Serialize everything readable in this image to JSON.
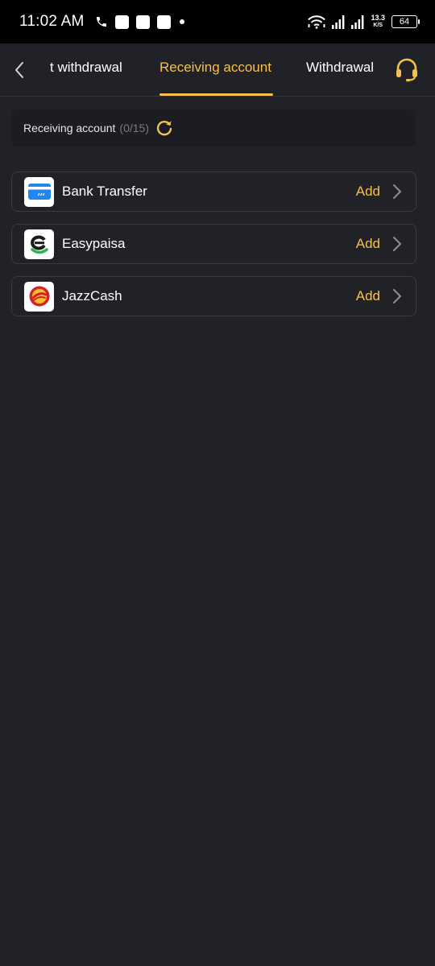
{
  "status_bar": {
    "time": "11:02 AM",
    "net_speed_value": "13.3",
    "net_speed_unit": "K/S",
    "battery": "64",
    "icons": [
      "phone-icon",
      "notification-icon",
      "notification-icon",
      "notification-icon",
      "dot-icon",
      "wifi-icon",
      "signal-icon",
      "signal-icon"
    ]
  },
  "nav": {
    "tabs": [
      {
        "label": "t withdrawal",
        "active": false
      },
      {
        "label": "Receiving account",
        "active": true
      },
      {
        "label": "Withdrawal",
        "active": false
      }
    ],
    "back_icon": "chevron-left-icon",
    "support_icon": "headset-icon"
  },
  "summary": {
    "label": "Receiving account",
    "count": "(0/15)",
    "refresh_icon": "refresh-icon"
  },
  "accounts": [
    {
      "name": "Bank Transfer",
      "action": "Add",
      "logo": "bank-card-icon"
    },
    {
      "name": "Easypaisa",
      "action": "Add",
      "logo": "easypaisa-logo"
    },
    {
      "name": "JazzCash",
      "action": "Add",
      "logo": "jazzcash-logo"
    }
  ],
  "colors": {
    "accent": "#f4c14e",
    "background": "#212228",
    "status_bar": "#000000"
  }
}
